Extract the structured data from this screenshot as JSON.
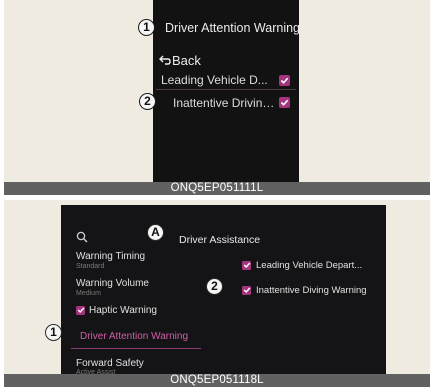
{
  "figure_top": {
    "screen_title": "Driver Attention Warning",
    "back_label": "Back",
    "items": [
      {
        "label": "Leading Vehicle Departure Alert",
        "display": "Leading Vehicle D...",
        "checked": true
      },
      {
        "label": "Inattentive Driving Warning",
        "display": "Inattentive Driving ...",
        "checked": true
      }
    ],
    "callouts": [
      "1",
      "2"
    ],
    "caption": "ONQ5EP051111L"
  },
  "figure_bottom": {
    "screen_title": "Driver Assistance",
    "left_menu": [
      {
        "label": "Warning Timing",
        "value": "Standard"
      },
      {
        "label": "Warning Volume",
        "value": "Medium"
      },
      {
        "label": "Haptic Warning",
        "checked": true
      },
      {
        "label": "Driver Attention Warning",
        "selected": true
      },
      {
        "label": "Forward Safety",
        "value": "Active Assist"
      }
    ],
    "right_options": [
      {
        "label": "Leading Vehicle Depart...",
        "checked": true
      },
      {
        "label": "Inattentive Diving Warning",
        "checked": true
      }
    ],
    "callouts": [
      "A",
      "2",
      "1"
    ],
    "caption": "ONQ5EP051118L"
  },
  "colors": {
    "accent_check": "#a4347e",
    "selected_text": "#d05ea8",
    "screen_bg": "#141416",
    "page_bg": "#f0ebe1",
    "caption_bar": "#616161"
  }
}
